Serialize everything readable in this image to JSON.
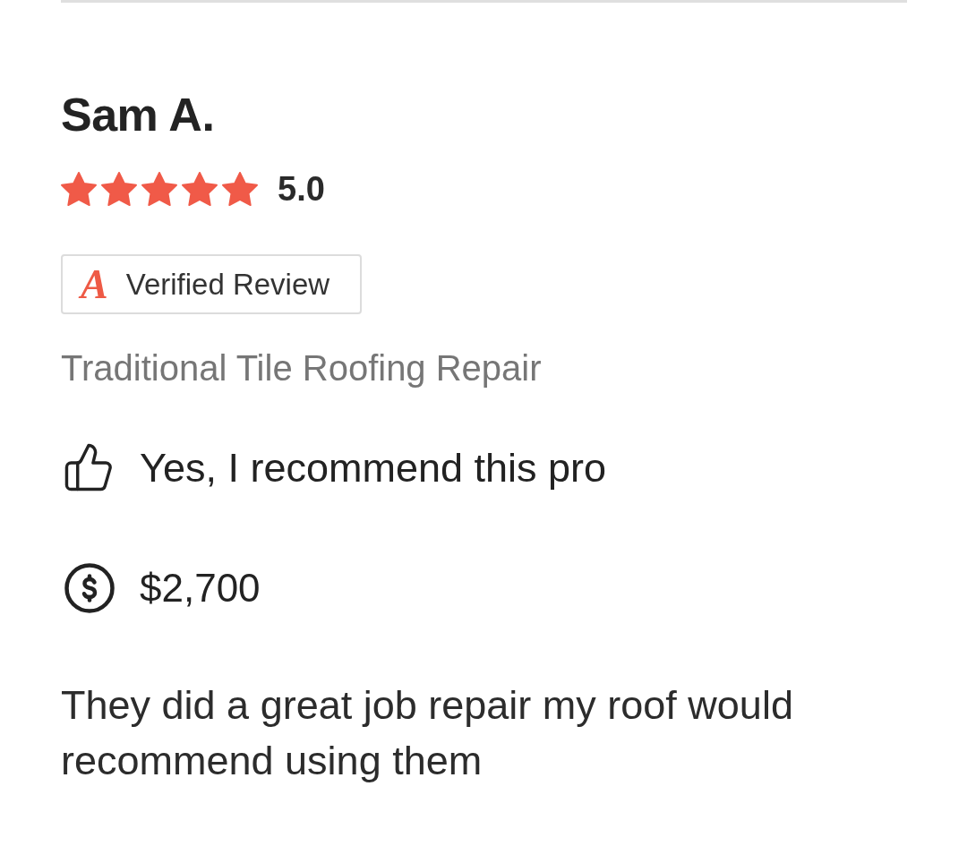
{
  "review": {
    "author": "Sam A.",
    "stars": 5,
    "rating": "5.0",
    "badge": {
      "logo": "A",
      "label": "Verified Review"
    },
    "service": "Traditional Tile Roofing Repair",
    "recommendation": "Yes, I recommend this pro",
    "price": "$2,700",
    "body": "They did a great job repair my roof would recommend using them"
  }
}
